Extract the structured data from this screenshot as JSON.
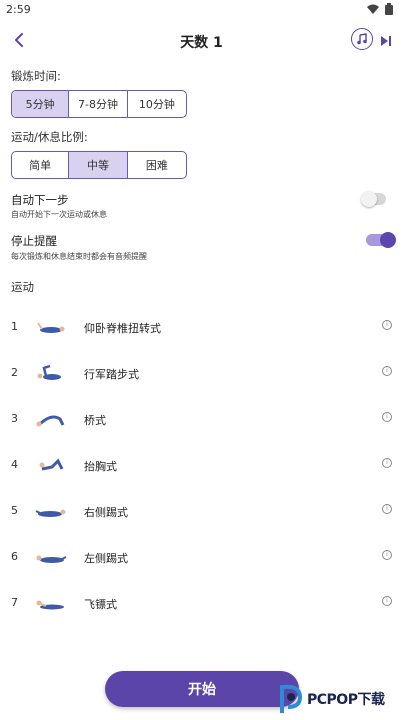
{
  "status": {
    "time": "2:59"
  },
  "header": {
    "title": "天数 1"
  },
  "duration": {
    "label": "锻炼时间:",
    "options": [
      "5分钟",
      "7-8分钟",
      "10分钟"
    ],
    "selected": "5分钟"
  },
  "ratio": {
    "label": "运动/休息比例:",
    "options": [
      "简单",
      "中等",
      "困难"
    ],
    "selected": "中等"
  },
  "auto_next": {
    "title": "自动下一步",
    "subtitle": "自动开始下一次运动或休息",
    "enabled": false
  },
  "stop_alert": {
    "title": "停止提醒",
    "subtitle": "每次锻炼和休息结束时都会有音频提醒",
    "enabled": true
  },
  "exercises": {
    "label": "运动",
    "items": [
      {
        "num": "1",
        "name": "仰卧脊椎扭转式"
      },
      {
        "num": "2",
        "name": "行军踏步式"
      },
      {
        "num": "3",
        "name": "桥式"
      },
      {
        "num": "4",
        "name": "抬胸式"
      },
      {
        "num": "5",
        "name": "右侧踢式"
      },
      {
        "num": "6",
        "name": "左侧踢式"
      },
      {
        "num": "7",
        "name": "飞镖式"
      }
    ]
  },
  "start_button": {
    "label": "开始"
  },
  "watermark": {
    "text": "PCPOP下载"
  },
  "colors": {
    "accent": "#5b45a8",
    "accent_light": "#d8d1ef",
    "switch_on_track": "#a996de"
  },
  "icons": [
    "back-arrow-icon",
    "music-note-icon",
    "skip-next-icon",
    "info-icon",
    "wifi-icon",
    "battery-icon"
  ]
}
